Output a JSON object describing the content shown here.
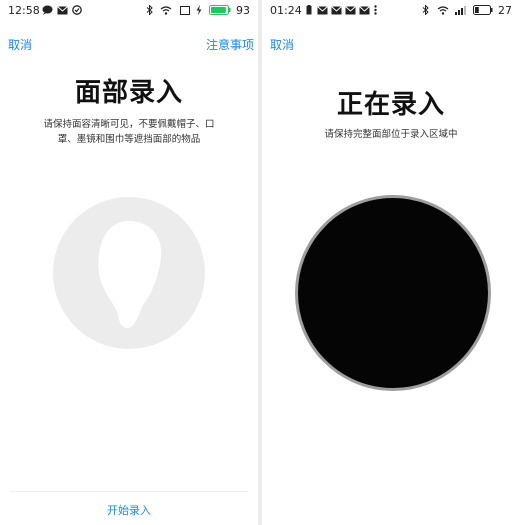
{
  "left_screen": {
    "status_bar": {
      "time": "12:58",
      "battery": "93"
    },
    "cancel_label": "取消",
    "notes_label": "注意事项",
    "title": "面部录入",
    "description_line1": "请保持面容清晰可见，不要佩戴帽子、口",
    "description_line2": "罩、墨镜和围巾等遮挡面部的物品",
    "start_label": "开始录入"
  },
  "right_screen": {
    "status_bar": {
      "time": "01:24",
      "battery": "27"
    },
    "cancel_label": "取消",
    "title": "正在录入",
    "subtitle": "请保持完整面部位于录入区域中"
  },
  "colors": {
    "accent": "#1e88e5",
    "battery_fill": "#22c55e",
    "circle_bg": "#ececec",
    "camera_black": "#050505"
  }
}
